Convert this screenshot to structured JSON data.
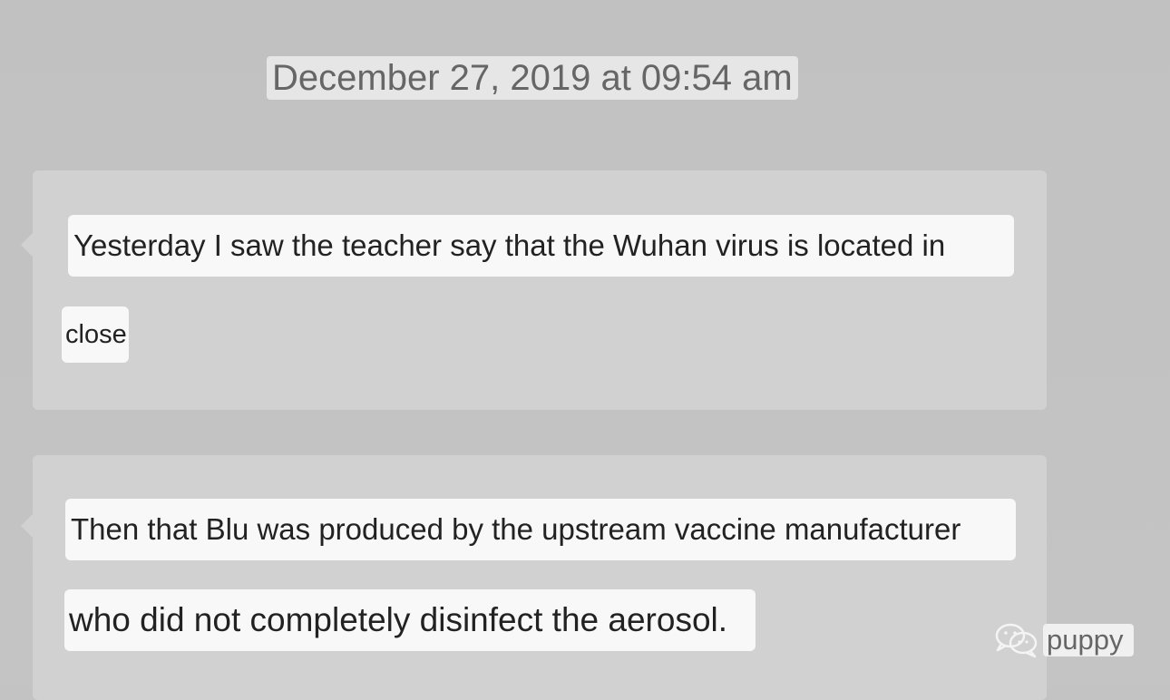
{
  "timestamp": "December 27, 2019 at 09:54 am",
  "messages": [
    {
      "lines": [
        "Yesterday I saw the teacher say that the Wuhan virus is located in",
        "close"
      ]
    },
    {
      "lines": [
        "Then that Blu was produced by the upstream vaccine manufacturer",
        "who did not completely disinfect the aerosol."
      ]
    }
  ],
  "watermark": {
    "icon": "wechat-icon",
    "label": "puppy"
  },
  "colors": {
    "background": "#c3c3c3",
    "bubble": "#d1d1d1",
    "text_highlight": "#f8f8f8",
    "text": "#222222",
    "timestamp_text": "#666666"
  }
}
